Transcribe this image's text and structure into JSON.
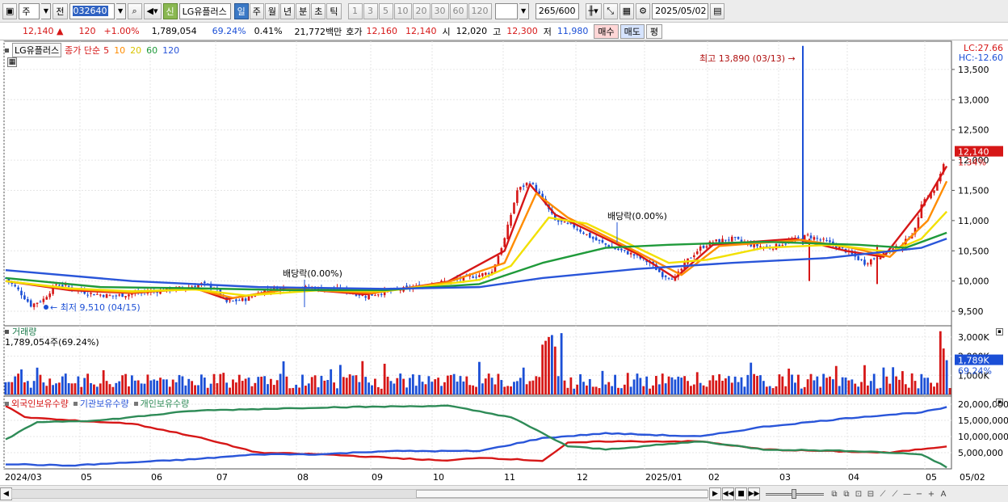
{
  "toolbar": {
    "period_select": "주",
    "prev_label": "전",
    "stock_code": "032640",
    "stock_name": "LG유플러스",
    "credit_badge": "신",
    "timeframes": [
      "일",
      "주",
      "월",
      "년",
      "분",
      "초",
      "틱"
    ],
    "active_timeframe": "일",
    "intervals": [
      "1",
      "3",
      "5",
      "10",
      "20",
      "30",
      "60",
      "120"
    ],
    "count": "265",
    "count_total": "/600",
    "date": "2025/05/02"
  },
  "quote": {
    "price": "12,140",
    "arrow": "▲",
    "change": "120",
    "change_pct": "+1.00%",
    "volume": "1,789,054",
    "volume_ratio": "69.24%",
    "turnover": "0.41%",
    "amount": "21,772백만",
    "hoga_label": "호가",
    "ask": "12,160",
    "bid": "12,140",
    "open_label": "시",
    "open": "12,020",
    "high_label": "고",
    "high": "12,300",
    "low_label": "저",
    "low": "11,980",
    "buy_label": "매수",
    "sell_label": "매도",
    "eval_label": "평"
  },
  "legend": {
    "stock": "LG유플러스",
    "price_type": "종가 단순",
    "ma_periods": [
      "5",
      "10",
      "20",
      "60",
      "120"
    ],
    "ma_colors": [
      "#d61717",
      "#ff8c00",
      "#f2e000",
      "#1f9a3a",
      "#2955d9"
    ]
  },
  "right_labels": {
    "lc": "LC:27.66",
    "hc": "HC:-12.60",
    "current_price": "12,140",
    "current_pct": "1.34%"
  },
  "price_axis": [
    "13,500",
    "13,000",
    "12,500",
    "12,000",
    "11,500",
    "11,000",
    "10,500",
    "10,000",
    "9,500"
  ],
  "annotations": {
    "high": "최고 13,890 (03/13)",
    "low": "최저 9,510 (04/15)",
    "dividend1": "배당락(0.00%)",
    "dividend2": "배당락(0.00%)"
  },
  "volume_panel": {
    "title": "거래량",
    "value": "1,789,054주(69.24%)",
    "axis": [
      "3,000K",
      "2,000K",
      "1,000K"
    ],
    "current": "1,789K",
    "current_pct": "69.24%"
  },
  "holding_panel": {
    "series": [
      "외국인보유수량",
      "기관보유수량",
      "개인보유수량"
    ],
    "colors": [
      "#d61717",
      "#2955d9",
      "#2e8b57"
    ],
    "axis": [
      "20,000,000",
      "15,000,000",
      "10,000,000",
      "5,000,000"
    ]
  },
  "x_axis": [
    "2024/03",
    "05",
    "06",
    "07",
    "08",
    "09",
    "10",
    "11",
    "12",
    "2025/01",
    "02",
    "03",
    "04",
    "05"
  ],
  "x_axis_right": "05/02",
  "chart_data": [
    {
      "type": "candlestick",
      "title": "LG유플러스",
      "ylim": [
        9300,
        13900
      ],
      "x": [
        "2024/03",
        "05",
        "06",
        "07",
        "08",
        "09",
        "10",
        "11",
        "12",
        "2025/01",
        "02",
        "03",
        "04",
        "05"
      ],
      "close_path": [
        [
          0,
          10050
        ],
        [
          4,
          9850
        ],
        [
          8,
          9600
        ],
        [
          12,
          9700
        ],
        [
          16,
          9950
        ],
        [
          20,
          9900
        ],
        [
          26,
          9800
        ],
        [
          34,
          9750
        ],
        [
          42,
          9800
        ],
        [
          50,
          9850
        ],
        [
          58,
          9900
        ],
        [
          62,
          9950
        ],
        [
          66,
          9900
        ],
        [
          70,
          9650
        ],
        [
          76,
          9700
        ],
        [
          82,
          9850
        ],
        [
          90,
          9900
        ],
        [
          98,
          9880
        ],
        [
          106,
          9860
        ],
        [
          114,
          9750
        ],
        [
          120,
          9820
        ],
        [
          130,
          9900
        ],
        [
          140,
          10000
        ],
        [
          150,
          10100
        ],
        [
          154,
          10150
        ],
        [
          158,
          10700
        ],
        [
          162,
          11500
        ],
        [
          166,
          11650
        ],
        [
          170,
          11350
        ],
        [
          174,
          11000
        ],
        [
          180,
          10900
        ],
        [
          186,
          10700
        ],
        [
          192,
          10550
        ],
        [
          198,
          10450
        ],
        [
          204,
          10300
        ],
        [
          208,
          10100
        ],
        [
          212,
          10050
        ],
        [
          216,
          10350
        ],
        [
          220,
          10550
        ],
        [
          224,
          10650
        ],
        [
          230,
          10700
        ],
        [
          236,
          10600
        ],
        [
          242,
          10550
        ],
        [
          248,
          10650
        ],
        [
          254,
          10750
        ],
        [
          260,
          10650
        ],
        [
          266,
          10500
        ],
        [
          272,
          10300
        ],
        [
          278,
          10450
        ],
        [
          284,
          10600
        ],
        [
          288,
          10850
        ],
        [
          290,
          11300
        ],
        [
          294,
          11500
        ],
        [
          296,
          11750
        ],
        [
          298,
          12140
        ]
      ],
      "ma": [
        {
          "name": "5",
          "values": [
            [
              0,
              10000
            ],
            [
              20,
              9850
            ],
            [
              40,
              9800
            ],
            [
              60,
              9880
            ],
            [
              70,
              9700
            ],
            [
              90,
              9880
            ],
            [
              114,
              9780
            ],
            [
              140,
              9990
            ],
            [
              158,
              10500
            ],
            [
              166,
              11600
            ],
            [
              174,
              11100
            ],
            [
              200,
              10450
            ],
            [
              212,
              10050
            ],
            [
              224,
              10600
            ],
            [
              250,
              10700
            ],
            [
              266,
              10500
            ],
            [
              278,
              10400
            ],
            [
              290,
              11200
            ],
            [
              298,
              11900
            ]
          ]
        },
        {
          "name": "10",
          "values": [
            [
              0,
              10000
            ],
            [
              20,
              9870
            ],
            [
              40,
              9810
            ],
            [
              60,
              9870
            ],
            [
              72,
              9720
            ],
            [
              90,
              9870
            ],
            [
              116,
              9800
            ],
            [
              140,
              9980
            ],
            [
              158,
              10300
            ],
            [
              168,
              11450
            ],
            [
              178,
              11050
            ],
            [
              200,
              10480
            ],
            [
              214,
              10100
            ],
            [
              226,
              10580
            ],
            [
              252,
              10680
            ],
            [
              268,
              10550
            ],
            [
              280,
              10400
            ],
            [
              292,
              11000
            ],
            [
              298,
              11650
            ]
          ]
        },
        {
          "name": "20",
          "values": [
            [
              0,
              10000
            ],
            [
              20,
              9880
            ],
            [
              40,
              9830
            ],
            [
              60,
              9860
            ],
            [
              76,
              9760
            ],
            [
              100,
              9850
            ],
            [
              120,
              9830
            ],
            [
              150,
              10020
            ],
            [
              160,
              10250
            ],
            [
              172,
              11050
            ],
            [
              184,
              10950
            ],
            [
              210,
              10300
            ],
            [
              222,
              10350
            ],
            [
              240,
              10550
            ],
            [
              262,
              10600
            ],
            [
              280,
              10480
            ],
            [
              290,
              10700
            ],
            [
              298,
              11150
            ]
          ]
        },
        {
          "name": "60",
          "values": [
            [
              0,
              10050
            ],
            [
              30,
              9900
            ],
            [
              60,
              9880
            ],
            [
              90,
              9850
            ],
            [
              120,
              9850
            ],
            [
              150,
              9950
            ],
            [
              170,
              10300
            ],
            [
              190,
              10550
            ],
            [
              210,
              10600
            ],
            [
              240,
              10650
            ],
            [
              270,
              10600
            ],
            [
              285,
              10550
            ],
            [
              298,
              10800
            ]
          ]
        },
        {
          "name": "120",
          "values": [
            [
              0,
              10180
            ],
            [
              40,
              10000
            ],
            [
              80,
              9900
            ],
            [
              120,
              9870
            ],
            [
              150,
              9900
            ],
            [
              170,
              10050
            ],
            [
              200,
              10200
            ],
            [
              230,
              10300
            ],
            [
              260,
              10380
            ],
            [
              290,
              10550
            ],
            [
              298,
              10700
            ]
          ]
        }
      ],
      "high": {
        "label": "최고",
        "value": 13890,
        "date": "03/13"
      },
      "low": {
        "label": "최저",
        "value": 9510,
        "date": "04/15"
      }
    },
    {
      "type": "bar",
      "title": "거래량",
      "ylim": [
        0,
        3500000
      ],
      "spikes": [
        [
          10,
          1400000
        ],
        [
          150,
          1700000
        ],
        [
          170,
          2600000
        ],
        [
          171,
          2800000
        ],
        [
          172,
          3000000
        ],
        [
          173,
          3100000
        ],
        [
          174,
          2500000
        ],
        [
          176,
          3200000
        ],
        [
          296,
          3300000
        ],
        [
          297,
          2400000
        ],
        [
          298,
          1789054
        ]
      ]
    },
    {
      "type": "line",
      "title": "보유수량",
      "ylim": [
        0,
        22000000
      ],
      "series": [
        {
          "name": "외국인보유수량",
          "values": [
            [
              0,
              19500000
            ],
            [
              6,
              16000000
            ],
            [
              20,
              15000000
            ],
            [
              40,
              14000000
            ],
            [
              60,
              10000000
            ],
            [
              80,
              5000000
            ],
            [
              100,
              4500000
            ],
            [
              120,
              3500000
            ],
            [
              140,
              2500000
            ],
            [
              150,
              3500000
            ],
            [
              170,
              2500000
            ],
            [
              178,
              8000000
            ],
            [
              190,
              8500000
            ],
            [
              220,
              8500000
            ],
            [
              240,
              6000000
            ],
            [
              260,
              5500000
            ],
            [
              280,
              5000000
            ],
            [
              298,
              7000000
            ]
          ]
        },
        {
          "name": "기관보유수량",
          "values": [
            [
              0,
              1500000
            ],
            [
              20,
              1000000
            ],
            [
              40,
              2000000
            ],
            [
              60,
              3000000
            ],
            [
              80,
              4500000
            ],
            [
              100,
              4500000
            ],
            [
              120,
              5500000
            ],
            [
              150,
              5500000
            ],
            [
              170,
              9500000
            ],
            [
              190,
              11000000
            ],
            [
              220,
              10000000
            ],
            [
              240,
              13000000
            ],
            [
              270,
              16000000
            ],
            [
              290,
              17500000
            ],
            [
              298,
              19000000
            ]
          ]
        },
        {
          "name": "개인보유수량",
          "values": [
            [
              0,
              9000000
            ],
            [
              10,
              14500000
            ],
            [
              30,
              15000000
            ],
            [
              60,
              18000000
            ],
            [
              100,
              19000000
            ],
            [
              140,
              19500000
            ],
            [
              160,
              16000000
            ],
            [
              178,
              7000000
            ],
            [
              190,
              6000000
            ],
            [
              220,
              8500000
            ],
            [
              240,
              6000000
            ],
            [
              270,
              5500000
            ],
            [
              290,
              4500000
            ],
            [
              298,
              500000
            ]
          ]
        }
      ]
    }
  ]
}
